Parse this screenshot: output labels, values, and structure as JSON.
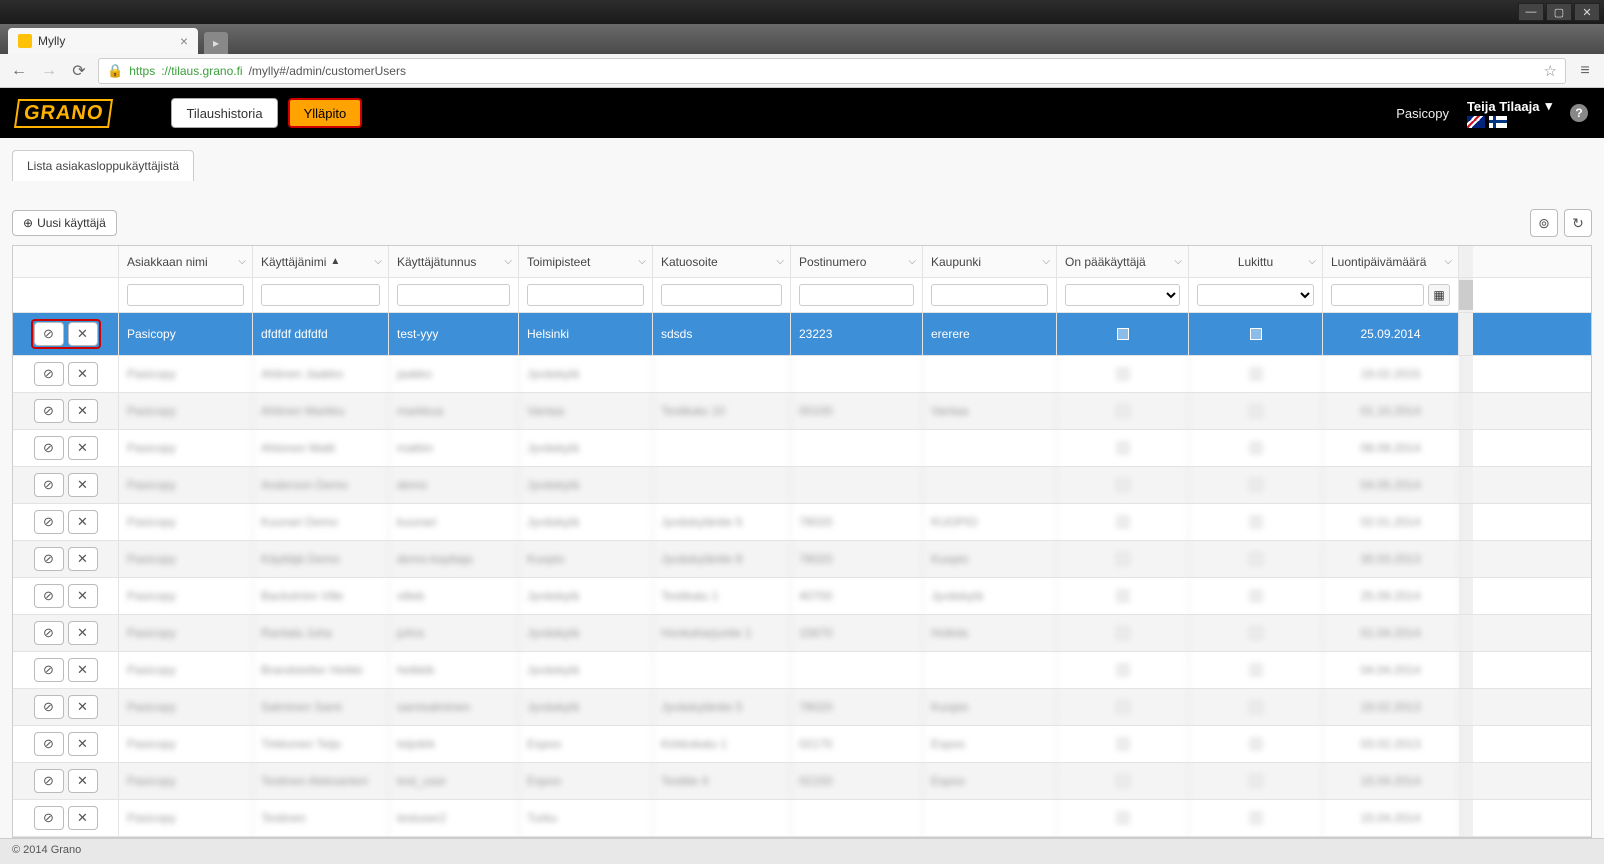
{
  "browser": {
    "tab_title": "Mylly",
    "url_scheme": "https",
    "url_host": "://tilaus.grano.fi",
    "url_path": "/mylly#/admin/customerUsers"
  },
  "header": {
    "logo": "GRANO",
    "nav": {
      "history": "Tilaushistoria",
      "admin": "Ylläpito"
    },
    "company": "Pasicopy",
    "user": "Teija Tilaaja"
  },
  "subtab": "Lista asiakasloppukäyttäjistä",
  "toolbar": {
    "new_user": "Uusi käyttäjä"
  },
  "columns": {
    "customer": "Asiakkaan nimi",
    "username": "Käyttäjänimi",
    "userid": "Käyttäjätunnus",
    "locations": "Toimipisteet",
    "street": "Katuosoite",
    "zip": "Postinumero",
    "city": "Kaupunki",
    "is_admin": "On pääkäyttäjä",
    "locked": "Lukittu",
    "created": "Luontipäivämäärä"
  },
  "rows": [
    {
      "customer": "Pasicopy",
      "username": "dfdfdf ddfdfd",
      "userid": "test-yyy",
      "locations": "Helsinki",
      "street": "sdsds",
      "zip": "23223",
      "city": "ererere",
      "is_admin": false,
      "locked": false,
      "created": "25.09.2014",
      "selected": true
    },
    {
      "customer": "Pasicopy",
      "username": "Ahtinen Jaakko",
      "userid": "jaakko",
      "locations": "Jyväskylä",
      "street": "",
      "zip": "",
      "city": "",
      "is_admin": false,
      "locked": false,
      "created": "19.02.2015"
    },
    {
      "customer": "Pasicopy",
      "username": "Ahtinen Markku",
      "userid": "markkua",
      "locations": "Vantaa",
      "street": "Testikatu 10",
      "zip": "00100",
      "city": "Vantaa",
      "is_admin": false,
      "locked": false,
      "created": "01.10.2014"
    },
    {
      "customer": "Pasicopy",
      "username": "Ahtonen Matti",
      "userid": "mattim",
      "locations": "Jyväskylä",
      "street": "",
      "zip": "",
      "city": "",
      "is_admin": true,
      "locked": false,
      "created": "08.09.2014"
    },
    {
      "customer": "Pasicopy",
      "username": "Anderson Demo",
      "userid": "demo",
      "locations": "Jyväskylä",
      "street": "",
      "zip": "",
      "city": "",
      "is_admin": false,
      "locked": false,
      "created": "04.05.2014"
    },
    {
      "customer": "Pasicopy",
      "username": "Kuunari Demo",
      "userid": "kuunari",
      "locations": "Jyväskylä",
      "street": "Jyväskyläntie 5",
      "zip": "78020",
      "city": "KUOPIO",
      "is_admin": false,
      "locked": false,
      "created": "02.01.2014"
    },
    {
      "customer": "Pasicopy",
      "username": "Käyttäjä Demo",
      "userid": "demo-kayttaja",
      "locations": "Kuopio",
      "street": "Jyväskyläntie 8",
      "zip": "78020",
      "city": "Kuopio",
      "is_admin": false,
      "locked": false,
      "created": "30.03.2013"
    },
    {
      "customer": "Pasicopy",
      "username": "Backström Ville",
      "userid": "villeb",
      "locations": "Jyväskylä",
      "street": "Testikatu 1",
      "zip": "40700",
      "city": "Jyväskylä",
      "is_admin": false,
      "locked": false,
      "created": "25.09.2014"
    },
    {
      "customer": "Pasicopy",
      "username": "Rantala Juha",
      "userid": "juhra",
      "locations": "Jyväskylä",
      "street": "Honkaharjuntie 1",
      "zip": "15670",
      "city": "Hollola",
      "is_admin": true,
      "locked": false,
      "created": "01.04.2014"
    },
    {
      "customer": "Pasicopy",
      "username": "Brandstetter Heikki",
      "userid": "heikkib",
      "locations": "Jyväskylä",
      "street": "",
      "zip": "",
      "city": "",
      "is_admin": true,
      "locked": false,
      "created": "04.04.2014"
    },
    {
      "customer": "Pasicopy",
      "username": "Salminen Sami",
      "userid": "samisalminen",
      "locations": "Jyväskylä",
      "street": "Jyväskyläntie 5",
      "zip": "78020",
      "city": "Kuopio",
      "is_admin": false,
      "locked": false,
      "created": "19.02.2013"
    },
    {
      "customer": "Pasicopy",
      "username": "Tirkkonen Teijo",
      "userid": "teijotirk",
      "locations": "Espoo",
      "street": "Kirkkokatu 1",
      "zip": "02170",
      "city": "Espoo",
      "is_admin": true,
      "locked": false,
      "created": "03.02.2013"
    },
    {
      "customer": "Pasicopy",
      "username": "Testinen Aleksanteri",
      "userid": "test_user",
      "locations": "Espoo",
      "street": "Testitie 4",
      "zip": "02150",
      "city": "Espoo",
      "is_admin": false,
      "locked": false,
      "created": "15.04.2014"
    },
    {
      "customer": "Pasicopy",
      "username": "Testinen",
      "userid": "testuser2",
      "locations": "Turku",
      "street": "",
      "zip": "",
      "city": "",
      "is_admin": false,
      "locked": false,
      "created": "15.04.2014"
    }
  ],
  "footer": "© 2014 Grano"
}
